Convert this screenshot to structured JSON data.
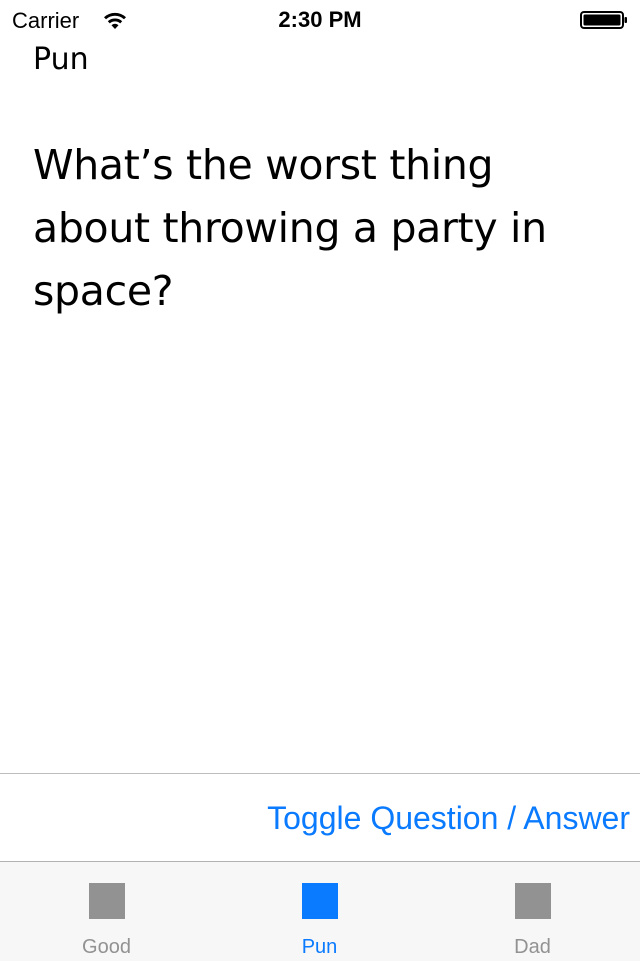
{
  "status_bar": {
    "carrier": "Carrier",
    "time": "2:30 PM",
    "icons": [
      "wifi-icon",
      "battery-icon"
    ]
  },
  "screen": {
    "category": "Pun",
    "question": "What’s the worst thing about throwing a party in space?"
  },
  "toolbar": {
    "toggle_label": "Toggle Question / Answer"
  },
  "tab_bar": {
    "selected": "Pun",
    "tabs": [
      {
        "label": "Good",
        "icon": "square-icon",
        "color": "#929292"
      },
      {
        "label": "Pun",
        "icon": "square-icon",
        "color": "#0a7aff"
      },
      {
        "label": "Dad",
        "icon": "square-icon",
        "color": "#929292"
      }
    ]
  },
  "colors": {
    "accent": "#0a7aff",
    "inactive": "#929292",
    "tab_bar_bg": "#f7f7f7"
  }
}
